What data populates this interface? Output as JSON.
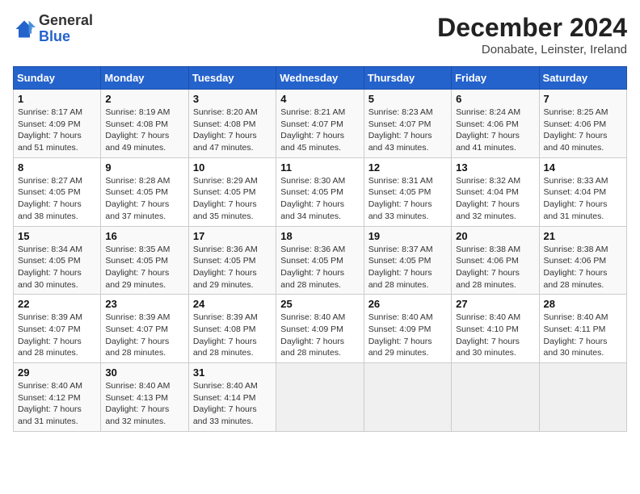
{
  "header": {
    "logo_general": "General",
    "logo_blue": "Blue",
    "title": "December 2024",
    "subtitle": "Donabate, Leinster, Ireland"
  },
  "calendar": {
    "days_of_week": [
      "Sunday",
      "Monday",
      "Tuesday",
      "Wednesday",
      "Thursday",
      "Friday",
      "Saturday"
    ],
    "weeks": [
      [
        {
          "day": "1",
          "sunrise": "8:17 AM",
          "sunset": "4:09 PM",
          "daylight": "7 hours and 51 minutes."
        },
        {
          "day": "2",
          "sunrise": "8:19 AM",
          "sunset": "4:08 PM",
          "daylight": "7 hours and 49 minutes."
        },
        {
          "day": "3",
          "sunrise": "8:20 AM",
          "sunset": "4:08 PM",
          "daylight": "7 hours and 47 minutes."
        },
        {
          "day": "4",
          "sunrise": "8:21 AM",
          "sunset": "4:07 PM",
          "daylight": "7 hours and 45 minutes."
        },
        {
          "day": "5",
          "sunrise": "8:23 AM",
          "sunset": "4:07 PM",
          "daylight": "7 hours and 43 minutes."
        },
        {
          "day": "6",
          "sunrise": "8:24 AM",
          "sunset": "4:06 PM",
          "daylight": "7 hours and 41 minutes."
        },
        {
          "day": "7",
          "sunrise": "8:25 AM",
          "sunset": "4:06 PM",
          "daylight": "7 hours and 40 minutes."
        }
      ],
      [
        {
          "day": "8",
          "sunrise": "8:27 AM",
          "sunset": "4:05 PM",
          "daylight": "7 hours and 38 minutes."
        },
        {
          "day": "9",
          "sunrise": "8:28 AM",
          "sunset": "4:05 PM",
          "daylight": "7 hours and 37 minutes."
        },
        {
          "day": "10",
          "sunrise": "8:29 AM",
          "sunset": "4:05 PM",
          "daylight": "7 hours and 35 minutes."
        },
        {
          "day": "11",
          "sunrise": "8:30 AM",
          "sunset": "4:05 PM",
          "daylight": "7 hours and 34 minutes."
        },
        {
          "day": "12",
          "sunrise": "8:31 AM",
          "sunset": "4:05 PM",
          "daylight": "7 hours and 33 minutes."
        },
        {
          "day": "13",
          "sunrise": "8:32 AM",
          "sunset": "4:04 PM",
          "daylight": "7 hours and 32 minutes."
        },
        {
          "day": "14",
          "sunrise": "8:33 AM",
          "sunset": "4:04 PM",
          "daylight": "7 hours and 31 minutes."
        }
      ],
      [
        {
          "day": "15",
          "sunrise": "8:34 AM",
          "sunset": "4:05 PM",
          "daylight": "7 hours and 30 minutes."
        },
        {
          "day": "16",
          "sunrise": "8:35 AM",
          "sunset": "4:05 PM",
          "daylight": "7 hours and 29 minutes."
        },
        {
          "day": "17",
          "sunrise": "8:36 AM",
          "sunset": "4:05 PM",
          "daylight": "7 hours and 29 minutes."
        },
        {
          "day": "18",
          "sunrise": "8:36 AM",
          "sunset": "4:05 PM",
          "daylight": "7 hours and 28 minutes."
        },
        {
          "day": "19",
          "sunrise": "8:37 AM",
          "sunset": "4:05 PM",
          "daylight": "7 hours and 28 minutes."
        },
        {
          "day": "20",
          "sunrise": "8:38 AM",
          "sunset": "4:06 PM",
          "daylight": "7 hours and 28 minutes."
        },
        {
          "day": "21",
          "sunrise": "8:38 AM",
          "sunset": "4:06 PM",
          "daylight": "7 hours and 28 minutes."
        }
      ],
      [
        {
          "day": "22",
          "sunrise": "8:39 AM",
          "sunset": "4:07 PM",
          "daylight": "7 hours and 28 minutes."
        },
        {
          "day": "23",
          "sunrise": "8:39 AM",
          "sunset": "4:07 PM",
          "daylight": "7 hours and 28 minutes."
        },
        {
          "day": "24",
          "sunrise": "8:39 AM",
          "sunset": "4:08 PM",
          "daylight": "7 hours and 28 minutes."
        },
        {
          "day": "25",
          "sunrise": "8:40 AM",
          "sunset": "4:09 PM",
          "daylight": "7 hours and 28 minutes."
        },
        {
          "day": "26",
          "sunrise": "8:40 AM",
          "sunset": "4:09 PM",
          "daylight": "7 hours and 29 minutes."
        },
        {
          "day": "27",
          "sunrise": "8:40 AM",
          "sunset": "4:10 PM",
          "daylight": "7 hours and 30 minutes."
        },
        {
          "day": "28",
          "sunrise": "8:40 AM",
          "sunset": "4:11 PM",
          "daylight": "7 hours and 30 minutes."
        }
      ],
      [
        {
          "day": "29",
          "sunrise": "8:40 AM",
          "sunset": "4:12 PM",
          "daylight": "7 hours and 31 minutes."
        },
        {
          "day": "30",
          "sunrise": "8:40 AM",
          "sunset": "4:13 PM",
          "daylight": "7 hours and 32 minutes."
        },
        {
          "day": "31",
          "sunrise": "8:40 AM",
          "sunset": "4:14 PM",
          "daylight": "7 hours and 33 minutes."
        },
        null,
        null,
        null,
        null
      ]
    ]
  }
}
